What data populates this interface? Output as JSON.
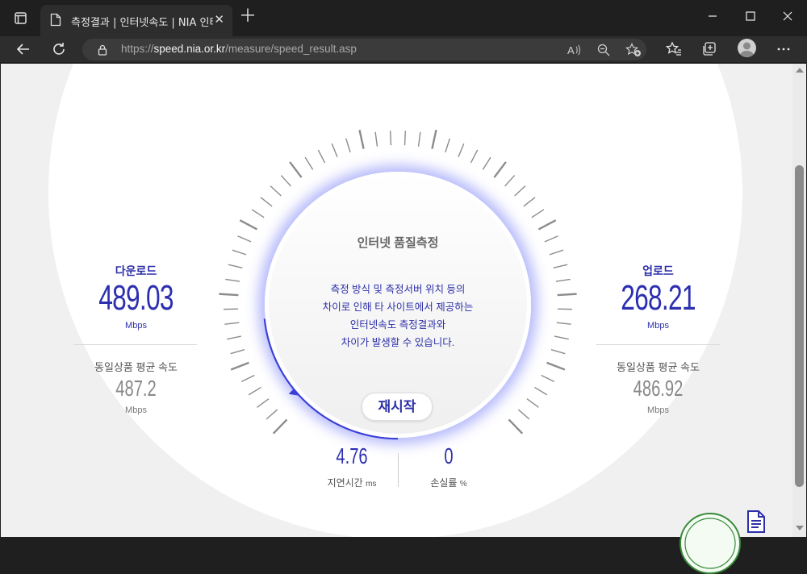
{
  "browser": {
    "tab_title": "측정결과 | 인터넷속도 | NIA 인터넷",
    "url_prefix": "https://",
    "url_domain": "speed.nia.or.kr",
    "url_path": "/measure/speed_result.asp"
  },
  "page": {
    "download": {
      "title": "다운로드",
      "value": "489.03",
      "unit": "Mbps",
      "avg_title": "동일상품 평균 속도",
      "avg_value": "487.2",
      "avg_unit": "Mbps"
    },
    "upload": {
      "title": "업로드",
      "value": "268.21",
      "unit": "Mbps",
      "avg_title": "동일상품 평균 속도",
      "avg_value": "486.92",
      "avg_unit": "Mbps"
    },
    "center": {
      "title": "인터넷 품질측정",
      "notice_lines": [
        "측정 방식 및 측정서버 위치 등의",
        "차이로 인해 타 사이트에서 제공하는",
        "인터넷속도 측정결과와",
        "차이가 발생할 수 있습니다."
      ],
      "restart_label": "재시작"
    },
    "latency": {
      "value": "4.76",
      "label": "지연시간",
      "unit": "ms"
    },
    "loss": {
      "value": "0",
      "label": "손실률",
      "unit": "%"
    }
  },
  "colors": {
    "accent": "#2c2fa8",
    "glow": "#5a64f5",
    "tick": "#8c8c8c"
  },
  "icons": [
    "tab-actions-icon",
    "document-icon",
    "close-icon",
    "plus-icon",
    "minimize-icon",
    "maximize-icon",
    "back-icon",
    "refresh-icon",
    "lock-icon",
    "read-aloud-icon",
    "zoom-out-icon",
    "add-favorite-icon",
    "favorites-icon",
    "collections-icon",
    "profile-icon",
    "more-icon"
  ]
}
